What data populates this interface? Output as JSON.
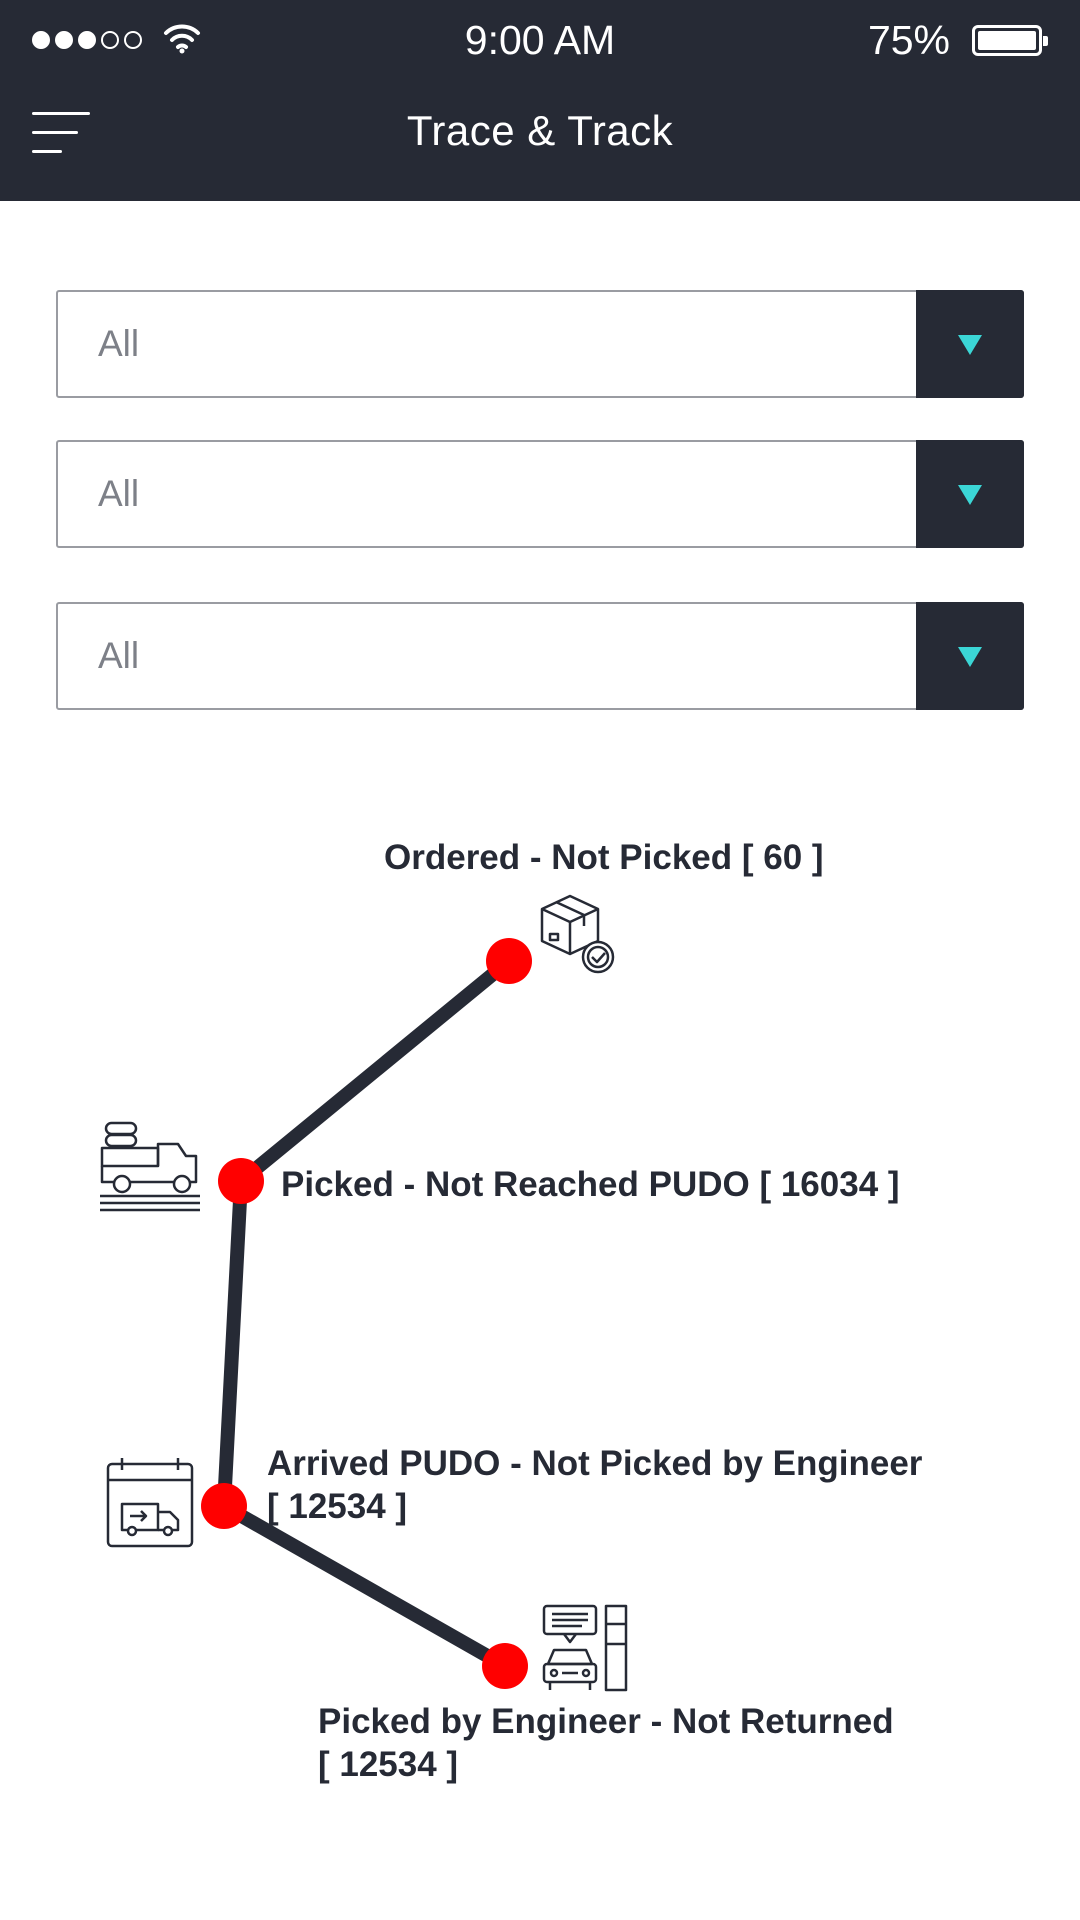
{
  "status_bar": {
    "time": "9:00 AM",
    "battery_percent": "75%",
    "signal_bars_filled": 3,
    "signal_bars_total": 5
  },
  "header": {
    "title": "Trace & Track",
    "menu_icon": "hamburger-menu-icon",
    "background": "#262a35"
  },
  "filters": [
    {
      "value": "All"
    },
    {
      "value": "All"
    },
    {
      "value": "All"
    }
  ],
  "stages": [
    {
      "label": "Ordered - Not Picked [ 60 ]",
      "icon": "package-check-icon"
    },
    {
      "label": "Picked - Not Reached PUDO [ 16034 ]",
      "icon": "pickup-truck-icon"
    },
    {
      "label": "Arrived PUDO - Not Picked by Engineer\n [ 12534 ]",
      "icon": "calendar-van-icon"
    },
    {
      "label": "Picked by Engineer - Not Returned\n [ 12534 ]",
      "icon": "service-station-car-icon"
    }
  ],
  "colors": {
    "accent": "#3bd6d6",
    "node": "#ff0000",
    "line": "#262a35"
  }
}
